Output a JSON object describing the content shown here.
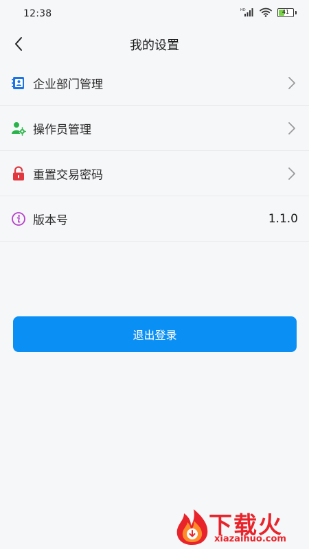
{
  "status_bar": {
    "time": "12:38",
    "network_badge": "HD",
    "battery_level_text": "41",
    "battery_level_percent": 41
  },
  "header": {
    "title": "我的设置"
  },
  "menu": {
    "items": [
      {
        "label": "企业部门管理",
        "icon": "contacts-book-icon",
        "icon_color": "#1a73e8",
        "has_chevron": true
      },
      {
        "label": "操作员管理",
        "icon": "user-gear-icon",
        "icon_color": "#2bb34b",
        "has_chevron": true
      },
      {
        "label": "重置交易密码",
        "icon": "lock-icon",
        "icon_color": "#e0383e",
        "has_chevron": true
      },
      {
        "label": "版本号",
        "icon": "info-icon",
        "icon_color": "#b541c9",
        "value": "1.1.0"
      }
    ]
  },
  "logout": {
    "label": "退出登录",
    "color": "#0a8ff5"
  },
  "watermark": {
    "brand": "下载火",
    "domain": "xiazaihuo.com",
    "color": "#e8242a"
  }
}
